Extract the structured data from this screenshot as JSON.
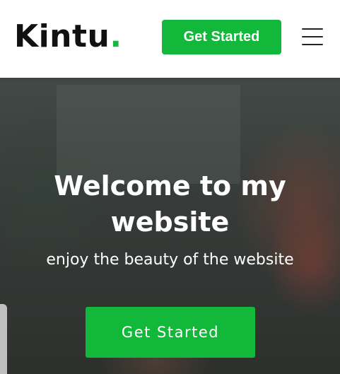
{
  "header": {
    "logo_text": "Kintu",
    "logo_dot": ".",
    "cta_label": "Get Started",
    "menu_icon": "hamburger-menu-icon"
  },
  "hero": {
    "title": "Welcome to my website",
    "subtitle": "enjoy the beauty of the website",
    "cta_label": "Get Started"
  },
  "colors": {
    "accent": "#12b83a",
    "logo_text": "#111111",
    "hero_text": "#ffffff"
  }
}
